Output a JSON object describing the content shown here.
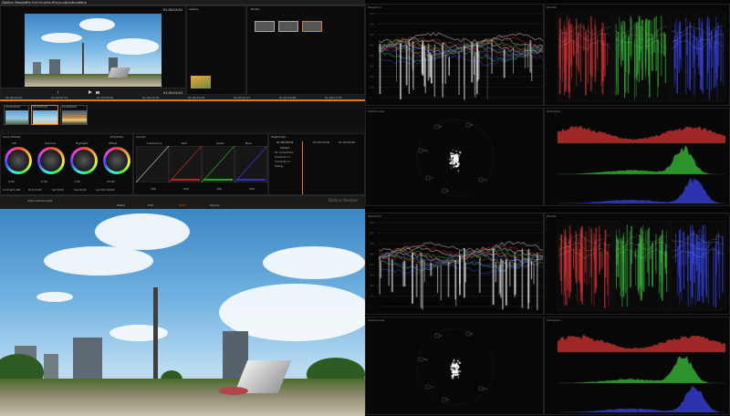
{
  "menubar": {
    "app": "DaVinci Resolve",
    "items": [
      "File",
      "Edit",
      "View",
      "Mark",
      "Playback",
      "Color",
      "Nodes",
      "Help"
    ]
  },
  "viewer": {
    "timecode": "01:00:04:02",
    "timecode2": "01:00:04:02",
    "ruler": [
      "01:00:00:00",
      "01:00:02:13",
      "01:00:05:02",
      "01:00:07:15",
      "01:00:10:04",
      "01:00:12:17",
      "01:00:15:06",
      "01:00:17:19"
    ]
  },
  "gallery": {
    "label": "Gallery",
    "nodes_label": "Nodes"
  },
  "clips": [
    {
      "tc": "01:00:00:00",
      "id": "V1"
    },
    {
      "tc": "01:00:02:14",
      "id": "V1"
    },
    {
      "tc": "01:00:05:03",
      "id": "V1"
    }
  ],
  "color_wheels": {
    "title": "Color Wheels",
    "mode": "Primaries",
    "wheels": [
      {
        "name": "Lift",
        "vals": [
          "0.00",
          "0.00",
          "0.00",
          "0.00"
        ]
      },
      {
        "name": "Gamma",
        "vals": [
          "0.00",
          "0.00",
          "0.00",
          "0.00"
        ]
      },
      {
        "name": "Highlight",
        "vals": [
          "1.00",
          "1.00",
          "1.00",
          "1.00"
        ]
      },
      {
        "name": "Offset",
        "vals": [
          "25.00",
          "25.00",
          "25.00",
          "25.00"
        ]
      }
    ],
    "footer": [
      "Contrast 1.000",
      "Pivot 0.435",
      "Sat 50.00",
      "Hue 50.00",
      "Lum Mix 100.00"
    ]
  },
  "curves": {
    "title": "Curves",
    "channels": [
      "Luminance",
      "Red",
      "Green",
      "Blue"
    ],
    "intensity": [
      "100",
      "100",
      "100",
      "100"
    ]
  },
  "keyframes": {
    "title": "Keyframes",
    "tc": "01:00:04:02",
    "tc2": "01:00:00:00",
    "tc3": "01:00:05:00",
    "master": "Master",
    "rows": [
      "01 Correctors",
      "Corrector 1",
      "Corrector 2",
      "Sizing"
    ]
  },
  "pages": [
    "Media",
    "Edit",
    "Color",
    "Deliver"
  ],
  "brand": "DaVinci Resolve",
  "status": "Auto Color/Curves",
  "scopes": {
    "waveform": "Waveform",
    "parade": "Parade",
    "vectorscope": "Vectorscope",
    "histogram": "Histogram",
    "wf_ticks": [
      "1023",
      "896",
      "768",
      "640",
      "512",
      "384",
      "256",
      "128",
      "0"
    ],
    "vec_labels": [
      "R",
      "Mg",
      "B",
      "Cy",
      "G",
      "Yl"
    ]
  },
  "colors": {
    "accent": "#e07b1b",
    "red": "#c83030",
    "green": "#36b636",
    "blue": "#3540d8"
  }
}
